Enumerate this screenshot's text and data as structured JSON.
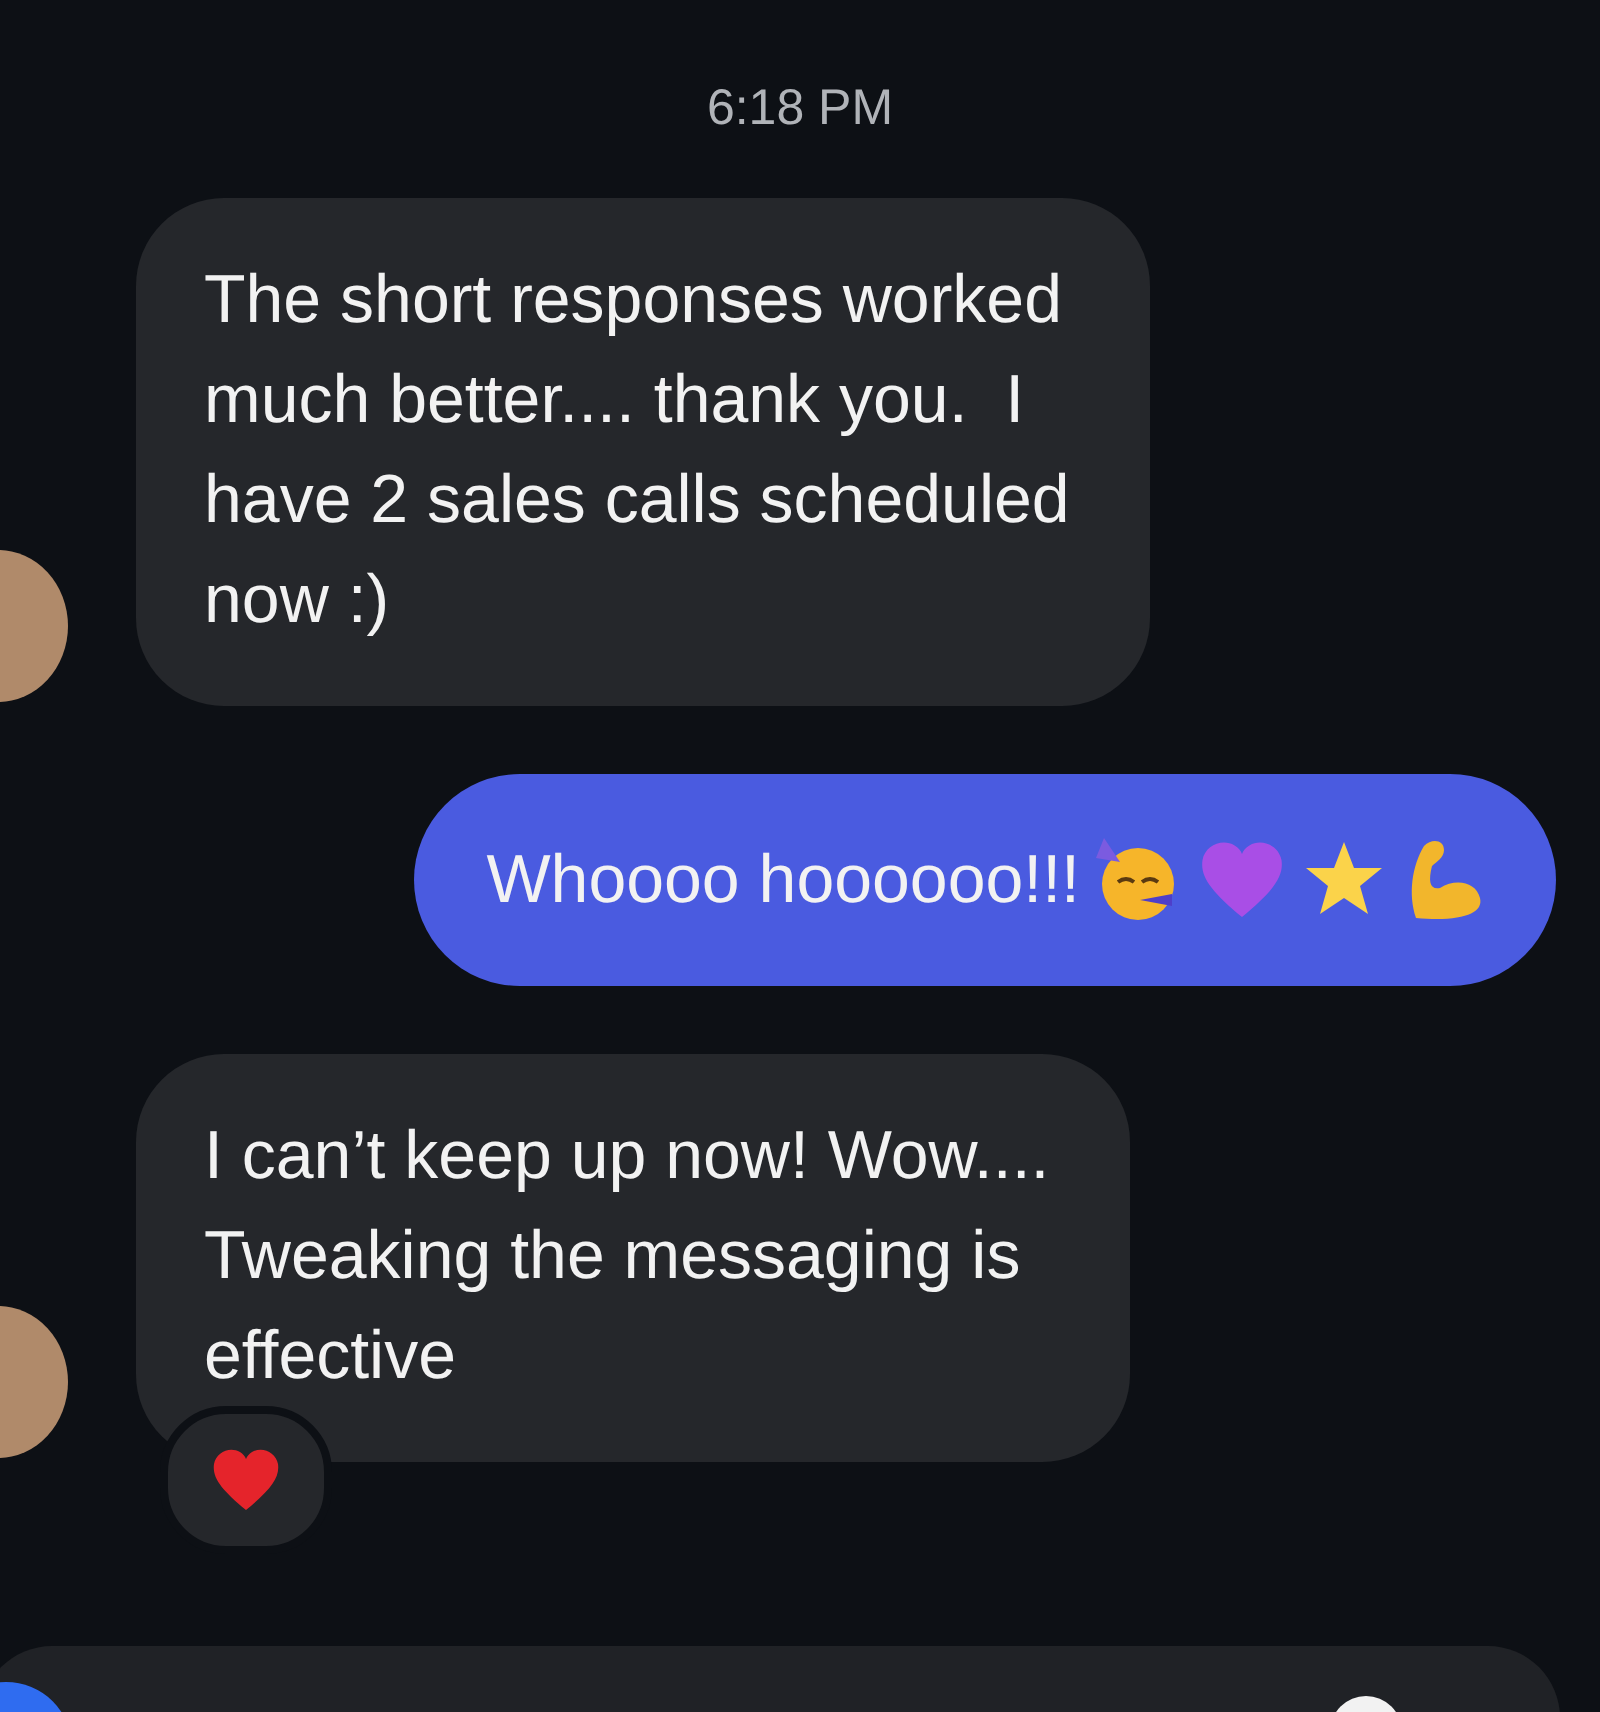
{
  "timestamp": "6:18 PM",
  "messages": [
    {
      "kind": "incoming",
      "text": "The short responses worked\nmuch better.... thank you.  I\nhave 2 sales calls scheduled\nnow :)",
      "reacted": false
    },
    {
      "kind": "outgoing",
      "text": "Whoooo hoooooo!!!",
      "reacted": false
    },
    {
      "kind": "incoming",
      "text": "I can’t keep up now! Wow....\nTweaking the messaging is\neffective",
      "reacted": true
    }
  ]
}
